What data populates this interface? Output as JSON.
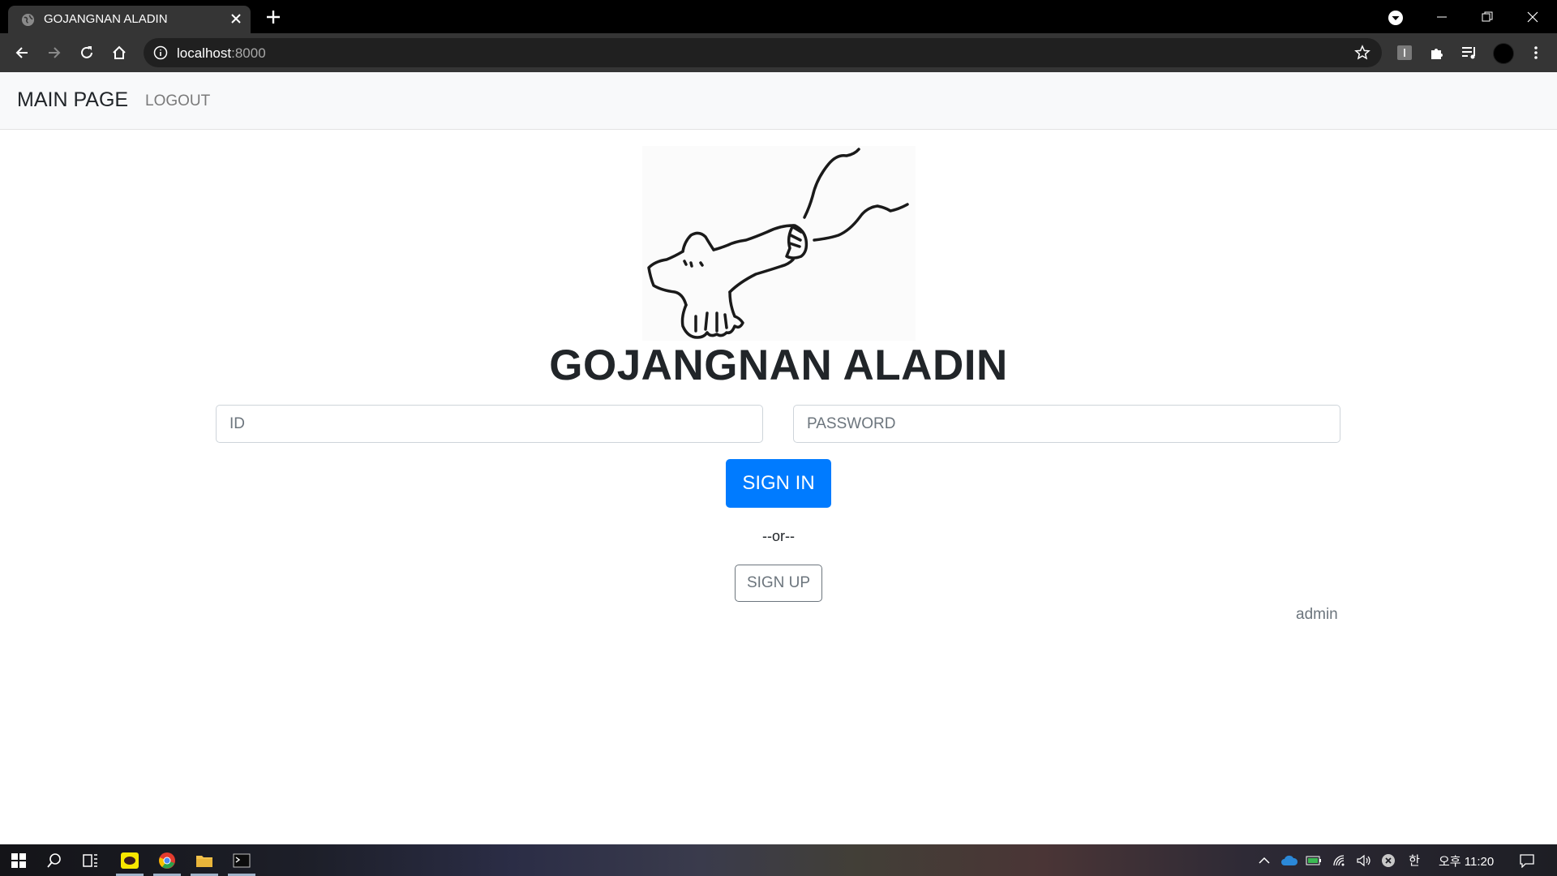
{
  "browser": {
    "tab_title": "GOJANGNAN ALADIN",
    "url_host": "localhost",
    "url_port": ":8000"
  },
  "navbar": {
    "brand": "MAIN PAGE",
    "logout": "LOGOUT"
  },
  "main": {
    "title": "GOJANGNAN ALADIN",
    "id_placeholder": "ID",
    "password_placeholder": "PASSWORD",
    "signin_label": "SIGN IN",
    "or_text": "--or--",
    "signup_label": "SIGN UP",
    "admin_label": "admin"
  },
  "taskbar": {
    "clock": "오후 11:20",
    "ime": "한"
  },
  "colors": {
    "primary": "#007bff",
    "secondary": "#6c757d",
    "navbar_bg": "#f8f9fa"
  }
}
